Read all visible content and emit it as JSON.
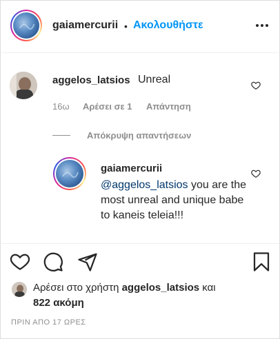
{
  "post": {
    "author": "gaiamercurii",
    "separator": "•",
    "follow_label": "Ακολουθήστε",
    "more_label": "•••"
  },
  "comment": {
    "username": "aggelos_latsios",
    "text": "Unreal",
    "age": "16ω",
    "likes_label": "Αρέσει σε 1",
    "reply_label": "Απάντηση",
    "hide_replies_label": "Απόκρυψη απαντήσεων"
  },
  "reply": {
    "username": "gaiamercurii",
    "mention": "@aggelos_latsios",
    "text": " you are the most unreal and unique babe to kaneis teleia!!!"
  },
  "likes": {
    "prefix": "Αρέσει στο χρήστη ",
    "user": "aggelos_latsios",
    "connector": " και",
    "others": "822 ακόμη"
  },
  "timestamp": "ΠΡΙΝ ΑΠΟ 17 ΩΡΕΣ",
  "icons": {
    "heart": "heart-icon",
    "comment": "comment-icon",
    "share": "share-icon",
    "bookmark": "bookmark-icon",
    "more": "more-icon"
  },
  "colors": {
    "accent": "#0095f6",
    "text": "#262626",
    "muted": "#8e8e8e"
  }
}
